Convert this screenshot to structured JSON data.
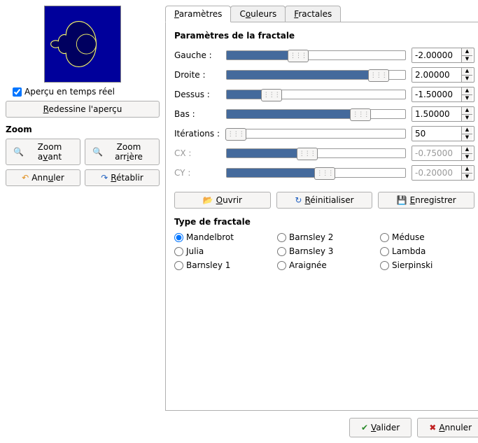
{
  "preview": {
    "checkbox_label": "Aperçu en temps réel",
    "checked": true,
    "redraw_label": "Redessine l'aperçu"
  },
  "zoom": {
    "title": "Zoom",
    "in_label": "Zoom avant",
    "out_label": "Zoom arrière",
    "undo_label": "Annuler",
    "redo_label": "Rétablir"
  },
  "tabs": {
    "params": "Paramètres",
    "colors": "Couleurs",
    "fractals": "Fractales"
  },
  "params": {
    "title": "Paramètres de la fractale",
    "rows": [
      {
        "label": "Gauche :",
        "value": "-2.00000",
        "fill": 40,
        "disabled": false
      },
      {
        "label": "Droite :",
        "value": "2.00000",
        "fill": 85,
        "disabled": false
      },
      {
        "label": "Dessus :",
        "value": "-1.50000",
        "fill": 25,
        "disabled": false
      },
      {
        "label": "Bas :",
        "value": "1.50000",
        "fill": 75,
        "disabled": false
      },
      {
        "label": "Itérations :",
        "value": "50",
        "fill": 5,
        "disabled": false
      },
      {
        "label": "CX :",
        "value": "-0.75000",
        "fill": 45,
        "disabled": true
      },
      {
        "label": "CY :",
        "value": "-0.20000",
        "fill": 55,
        "disabled": true
      }
    ]
  },
  "actions": {
    "open": "Ouvrir",
    "reset": "Réinitialiser",
    "save": "Enregistrer"
  },
  "fractal_type": {
    "title": "Type de fractale",
    "options": [
      "Mandelbrot",
      "Barnsley 2",
      "Méduse",
      "Julia",
      "Barnsley 3",
      "Lambda",
      "Barnsley 1",
      "Araignée",
      "Sierpinski"
    ],
    "selected": "Mandelbrot"
  },
  "footer": {
    "ok": "Valider",
    "cancel": "Annuler"
  }
}
